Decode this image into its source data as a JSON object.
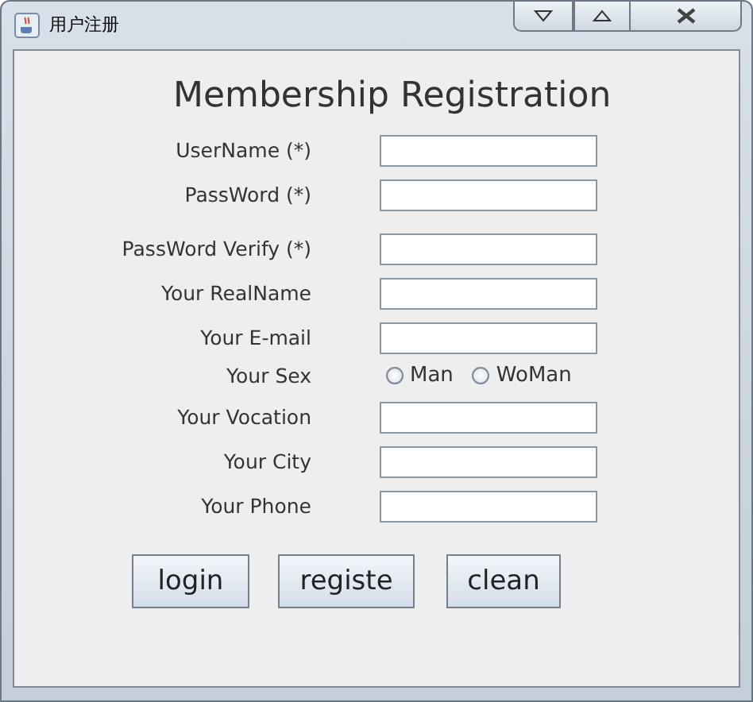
{
  "window": {
    "title": "用户注册"
  },
  "heading": "Membership Registration",
  "fields": [
    {
      "kind": "text",
      "label": "UserName (*)"
    },
    {
      "kind": "text",
      "label": "PassWord (*)"
    },
    {
      "kind": "text",
      "label": "PassWord Verify (*)"
    },
    {
      "kind": "text",
      "label": "Your RealName"
    },
    {
      "kind": "text",
      "label": "Your E-mail"
    },
    {
      "kind": "radio",
      "label": "Your Sex",
      "options": [
        {
          "label": "Man",
          "selected": false
        },
        {
          "label": "WoMan",
          "selected": false
        }
      ]
    },
    {
      "kind": "text",
      "label": "Your Vocation"
    },
    {
      "kind": "text",
      "label": "Your City"
    },
    {
      "kind": "text",
      "label": "Your Phone"
    }
  ],
  "buttons": [
    "login",
    "registe",
    "clean"
  ]
}
